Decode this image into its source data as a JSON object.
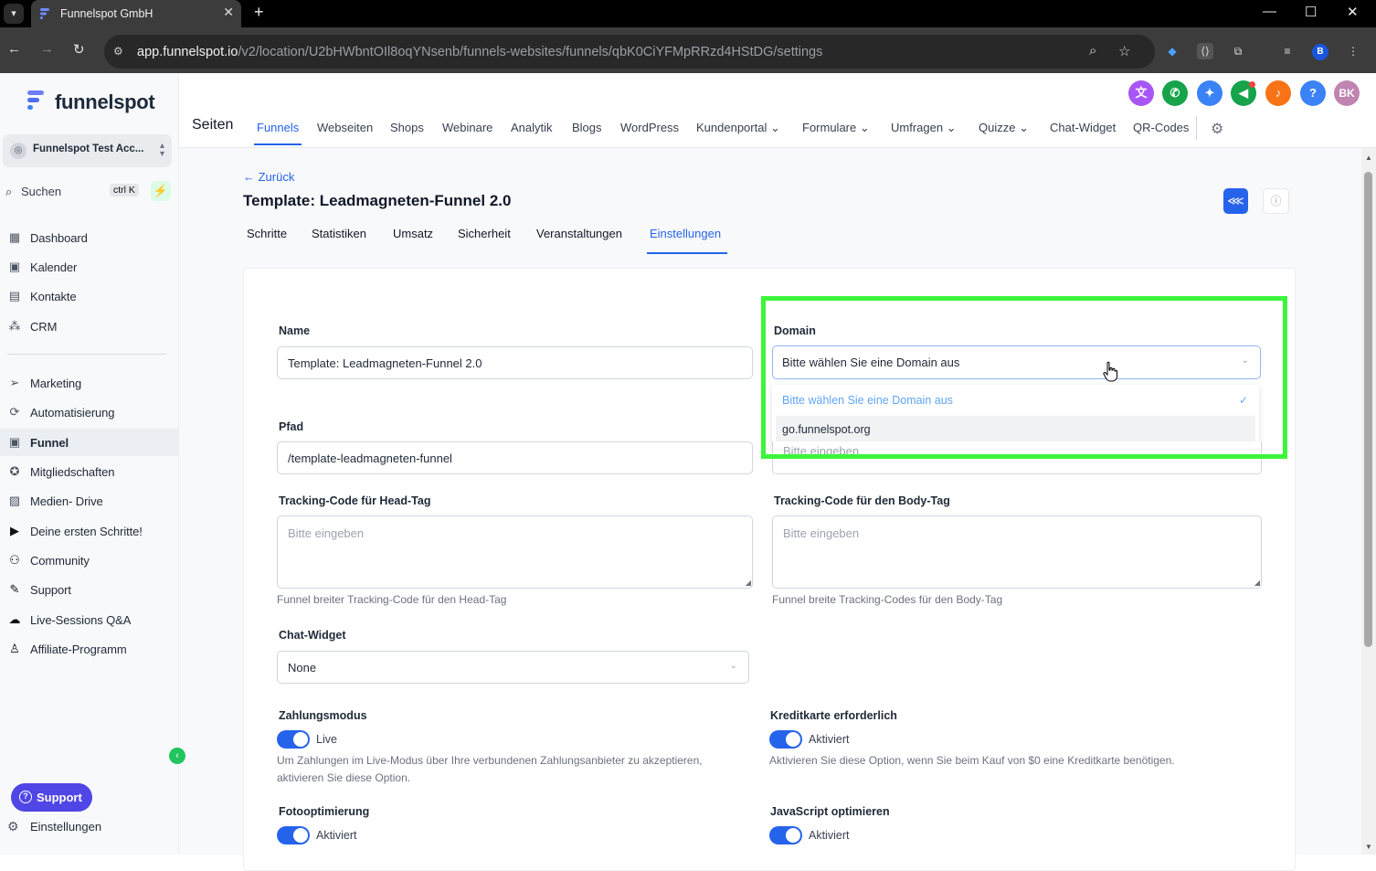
{
  "browser": {
    "tab_title": "Funnelspot GmbH",
    "url_host": "app.funnelspot.io",
    "url_path": "/v2/location/U2bHWbntOIl8oqYNsenb/funnels-websites/funnels/qbK0CiYFMpRRzd4HStDG/settings",
    "profile_initial": "B"
  },
  "sidebar": {
    "logo_text": "funnelspot",
    "account_name": "Funnelspot Test Acc...",
    "search_label": "Suchen",
    "search_shortcut": "ctrl K",
    "items": [
      {
        "label": "Dashboard",
        "icon": "grid-icon"
      },
      {
        "label": "Kalender",
        "icon": "calendar-icon"
      },
      {
        "label": "Kontakte",
        "icon": "contacts-icon"
      },
      {
        "label": "CRM",
        "icon": "crm-icon"
      },
      {
        "label": "Marketing",
        "icon": "send-icon"
      },
      {
        "label": "Automatisierung",
        "icon": "automation-icon"
      },
      {
        "label": "Funnel",
        "icon": "funnel-icon",
        "active": true
      },
      {
        "label": "Mitgliedschaften",
        "icon": "membership-icon"
      },
      {
        "label": "Medien- Drive",
        "icon": "media-icon"
      },
      {
        "label": "Deine ersten Schritte!",
        "icon": "play-icon"
      },
      {
        "label": "Community",
        "icon": "community-icon"
      },
      {
        "label": "Support",
        "icon": "wrench-icon"
      },
      {
        "label": "Live-Sessions Q&A",
        "icon": "live-icon"
      },
      {
        "label": "Affiliate-Programm",
        "icon": "affiliate-icon"
      }
    ],
    "support_button": "Support",
    "settings_label": "Einstellungen"
  },
  "header": {
    "section_title": "Seiten",
    "avatar_initials": "BK",
    "menu": [
      "Funnels",
      "Webseiten",
      "Shops",
      "Webinare",
      "Analytik",
      "Blogs",
      "WordPress",
      "Kundenportal",
      "Formulare",
      "Umfragen",
      "Quizze",
      "Chat-Widget",
      "QR-Codes"
    ],
    "active_menu": "Funnels"
  },
  "page": {
    "back_label": "← Zurück",
    "title": "Template: Leadmagneten-Funnel 2.0",
    "tabs": [
      "Schritte",
      "Statistiken",
      "Umsatz",
      "Sicherheit",
      "Veranstaltungen",
      "Einstellungen"
    ],
    "active_tab": "Einstellungen"
  },
  "form": {
    "name_label": "Name",
    "name_value": "Template: Leadmagneten-Funnel 2.0",
    "domain_label": "Domain",
    "domain_value": "Bitte wählen Sie eine Domain aus",
    "domain_options": [
      "Bitte wählen Sie eine Domain aus",
      "go.funnelspot.org"
    ],
    "path_label": "Pfad",
    "path_value": "/template-leadmagneten-funnel",
    "hidden_field_placeholder": "Bitte eingeben",
    "head_tag_label": "Tracking-Code für Head-Tag",
    "head_tag_placeholder": "Bitte eingeben",
    "head_tag_help": "Funnel breiter Tracking-Code für den Head-Tag",
    "body_tag_label": "Tracking-Code für den Body-Tag",
    "body_tag_placeholder": "Bitte eingeben",
    "body_tag_help": "Funnel breite Tracking-Codes für den Body-Tag",
    "chat_widget_label": "Chat-Widget",
    "chat_widget_value": "None",
    "payment_mode_label": "Zahlungsmodus",
    "payment_mode_state": "Live",
    "payment_mode_help_1": "Um Zahlungen im Live-Modus über Ihre verbundenen Zahlungsanbieter zu akzeptieren,",
    "payment_mode_help_2": "aktivieren Sie diese Option.",
    "credit_card_label": "Kreditkarte erforderlich",
    "credit_card_state": "Aktiviert",
    "credit_card_help": "Aktivieren Sie diese Option, wenn Sie beim Kauf von $0 eine Kreditkarte benötigen.",
    "photo_opt_label": "Fotooptimierung",
    "photo_opt_state": "Aktiviert",
    "js_opt_label": "JavaScript optimieren",
    "js_opt_state": "Aktiviert"
  },
  "colors": {
    "accent": "#2563eb",
    "highlight": "#3cf53c",
    "support_button": "#4f46e5"
  }
}
